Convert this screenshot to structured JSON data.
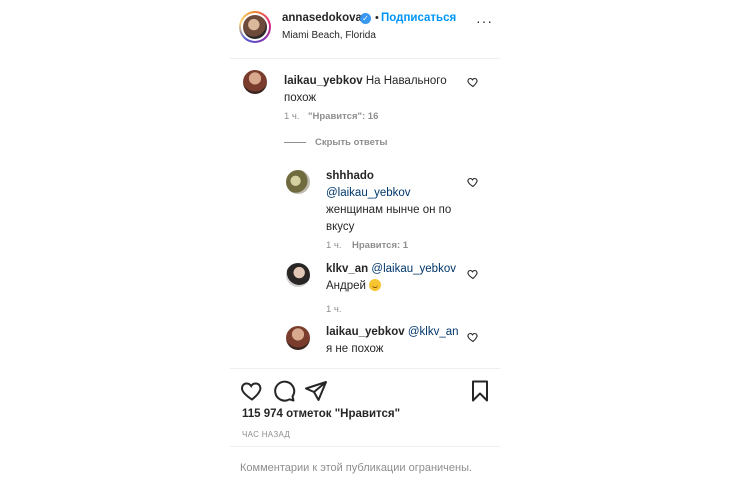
{
  "header": {
    "username": "annasedokova",
    "separator": "•",
    "follow_label": "Подписаться",
    "location": "Miami Beach, Florida",
    "more_label": "···"
  },
  "comments": [
    {
      "username": "laikau_yebkov",
      "text": "На Навального похож",
      "time": "1 ч.",
      "likes": "\"Нравится\": 16",
      "hide_replies": "Скрыть ответы",
      "replies": [
        {
          "username": "shhhado",
          "mention": "@laikau_yebkov",
          "text_line1": "женщинам нынче он по",
          "text_line2": "вкусу",
          "time": "1 ч.",
          "likes": "Нравится: 1"
        },
        {
          "username": "klkv_an",
          "mention": "@laikau_yebkov",
          "text": "Андрей",
          "time": "1 ч."
        },
        {
          "username": "laikau_yebkov",
          "mention": "@klkv_an",
          "text": "я не похож"
        }
      ]
    }
  ],
  "post": {
    "likes_count": "115 974 отметок \"Нравится\"",
    "time_ago": "ЧАС НАЗАД",
    "comments_restricted": "Комментарии к этой публикации ограничены."
  },
  "icons": {
    "like": "heart-icon",
    "comment": "comment-icon",
    "share": "share-icon",
    "save": "bookmark-icon",
    "verified": "verified-badge-icon",
    "emoji": "laughing-emoji-icon"
  },
  "colors": {
    "accent": "#0095f6",
    "mention": "#00376b",
    "muted": "#8e8e8e",
    "text": "#262626"
  }
}
